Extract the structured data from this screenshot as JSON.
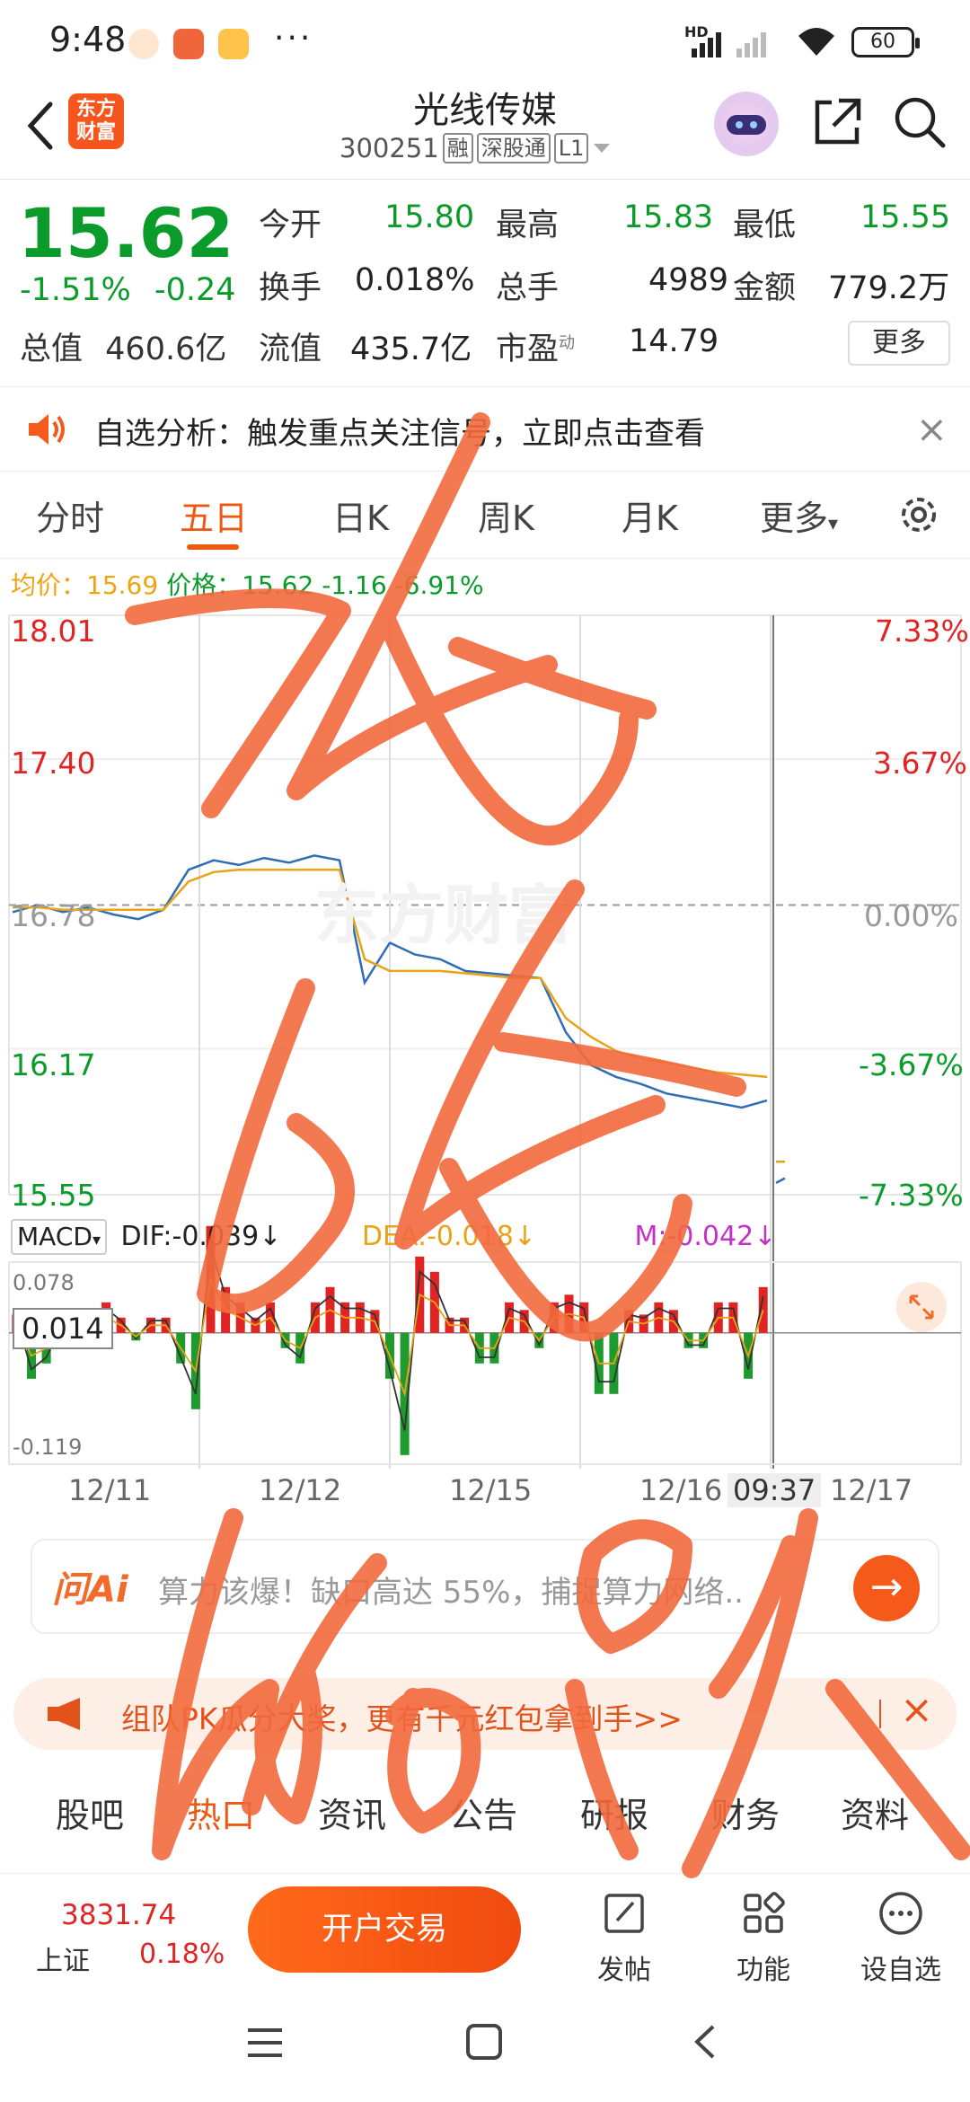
{
  "status": {
    "time": "9:48",
    "more": "···",
    "hd": "HD",
    "battery": "60"
  },
  "header": {
    "logo_line1": "东方",
    "logo_line2": "财富",
    "name": "光线传媒",
    "code": "300251",
    "tags": [
      "融",
      "深股通",
      "L1"
    ]
  },
  "quote": {
    "price": "15.62",
    "change_pct": "-1.51%",
    "change": "-0.24",
    "total_label": "总值",
    "total_value": "460.6亿",
    "rows": [
      [
        {
          "label": "今开",
          "value": "15.80"
        },
        {
          "label": "最高",
          "value": "15.83"
        },
        {
          "label": "最低",
          "value": "15.55"
        }
      ],
      [
        {
          "label": "换手",
          "value": "0.018%"
        },
        {
          "label": "总手",
          "value": "4989"
        },
        {
          "label": "金额",
          "value": "779.2万"
        }
      ],
      [
        {
          "label": "流值",
          "value": "435.7亿"
        },
        {
          "label": "市盈",
          "value": "14.79",
          "sup": "动"
        }
      ]
    ],
    "more_button": "更多"
  },
  "notice": {
    "text": "自选分析：触发重点关注信号，立即点击查看",
    "close": "×"
  },
  "kline_tabs": {
    "items": [
      "分时",
      "五日",
      "日K",
      "周K",
      "月K",
      "更多"
    ],
    "active": "五日"
  },
  "avg_line": {
    "avg_label": "均价：",
    "avg_value": "15.69",
    "price_label": "价格：",
    "price_value": "15.62",
    "change": "-1.16",
    "pct": "-6.91%"
  },
  "chart_data": {
    "type": "line",
    "title": "",
    "y_left_ticks": [
      "18.01",
      "17.40",
      "16.78",
      "16.17",
      "15.55"
    ],
    "y_right_ticks": [
      "7.33%",
      "3.67%",
      "0.00%",
      "-3.67%",
      "-7.33%"
    ],
    "ylim": [
      15.55,
      18.01
    ],
    "x_labels": [
      "12/11",
      "12/12",
      "12/15",
      "12/16",
      "12/17"
    ],
    "cursor_time": "09:37",
    "watermark": "东方财富",
    "series": [
      {
        "name": "价格",
        "color": "#2f6db5",
        "values": [
          16.75,
          16.78,
          16.75,
          16.77,
          16.74,
          16.72,
          16.76,
          16.93,
          16.97,
          16.95,
          16.98,
          16.96,
          16.99,
          16.97,
          16.45,
          16.62,
          16.57,
          16.55,
          16.5,
          16.49,
          16.48,
          16.47,
          16.24,
          16.1,
          16.05,
          16.02,
          15.98,
          15.96,
          15.94,
          15.92,
          15.95,
          15.6,
          15.62
        ]
      },
      {
        "name": "均价",
        "color": "#e8a317",
        "values": [
          16.77,
          16.77,
          16.76,
          16.76,
          16.76,
          16.76,
          16.76,
          16.88,
          16.92,
          16.93,
          16.93,
          16.93,
          16.93,
          16.93,
          16.55,
          16.5,
          16.5,
          16.5,
          16.49,
          16.48,
          16.47,
          16.47,
          16.3,
          16.22,
          16.16,
          16.13,
          16.11,
          16.09,
          16.07,
          16.06,
          16.05,
          15.69,
          15.69
        ]
      }
    ],
    "macd": {
      "selector": "MACD",
      "dif_label": "DIF:-0.039",
      "dea_label": "DEA:-0.018",
      "macd_label": "M:-0.042",
      "arrow": "↓",
      "y_top": "0.078",
      "y_bottom": "-0.119",
      "current": "0.014",
      "bars": [
        0.012,
        -0.03,
        -0.02,
        0.005,
        -0.01,
        0.015,
        0.02,
        0.01,
        -0.005,
        0.01,
        0.01,
        -0.02,
        -0.05,
        0.07,
        0.03,
        0.02,
        0.01,
        0.02,
        -0.01,
        -0.02,
        0.02,
        0.03,
        0.02,
        0.02,
        0.015,
        -0.03,
        -0.08,
        0.05,
        0.04,
        0.01,
        0.01,
        -0.02,
        -0.02,
        0.02,
        0.015,
        -0.01,
        0.02,
        0.025,
        0.02,
        -0.04,
        -0.04,
        0.015,
        0.012,
        0.02,
        0.015,
        -0.01,
        -0.01,
        0.02,
        0.02,
        -0.03,
        0.03
      ]
    }
  },
  "ai_bar": {
    "logo": "问Ai",
    "text": "算力该爆！缺口高达 55%，捕捉算力网络..",
    "go": "→"
  },
  "promo": {
    "text": "组队PK瓜分大奖，更有千元红包拿到手>>",
    "close": "×"
  },
  "bottom_tabs": {
    "items": [
      "股吧",
      "热口",
      "资讯",
      "公告",
      "研报",
      "财务",
      "资料"
    ],
    "active": "热口"
  },
  "bottombar": {
    "index_value": "3831.74",
    "index_name": "上证",
    "index_change": "0.18%",
    "trade_button": "开户交易",
    "tools": [
      "发帖",
      "功能",
      "设自选"
    ]
  },
  "colors": {
    "accent": "#ea5a12",
    "down": "#0a9b2b",
    "up": "#e02424",
    "scribble": "#f26a3d"
  }
}
